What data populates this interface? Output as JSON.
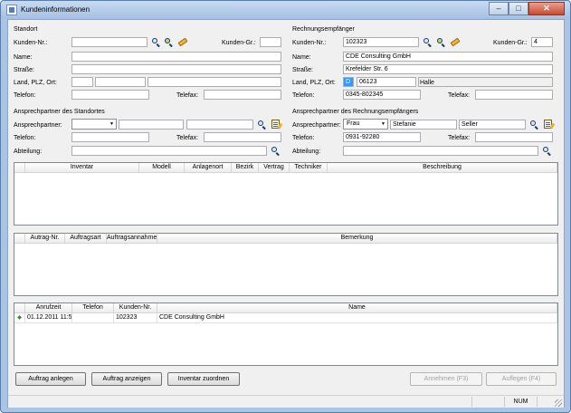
{
  "window": {
    "title": "Kundeninformationen",
    "minimize": "–",
    "maximize": "□",
    "close": "✕"
  },
  "standort": {
    "heading": "Standort",
    "kunden_nr_label": "Kunden-Nr.:",
    "kunden_nr_value": "",
    "kunden_gr_label": "Kunden-Gr.:",
    "kunden_gr_value": "",
    "name_label": "Name:",
    "name_value": "",
    "strasse_label": "Straße:",
    "strasse_value": "",
    "land_label": "Land, PLZ, Ort:",
    "land_value": "",
    "plz_value": "",
    "ort_value": "",
    "telefon_label": "Telefon:",
    "telefon_value": "",
    "telefax_label": "Telefax:",
    "telefax_value": ""
  },
  "rechnung": {
    "heading": "Rechnungsempfänger",
    "kunden_nr_label": "Kunden-Nr.:",
    "kunden_nr_value": "102323",
    "kunden_gr_label": "Kunden-Gr.:",
    "kunden_gr_value": "4",
    "name_label": "Name:",
    "name_value": "CDE Consulting GmbH",
    "strasse_label": "Straße:",
    "strasse_value": "Krefelder Str. 6",
    "land_label": "Land, PLZ, Ort:",
    "land_value": "D",
    "plz_value": "06123",
    "ort_value": "Halle",
    "telefon_label": "Telefon:",
    "telefon_value": "0345-802345",
    "telefax_label": "Telefax:",
    "telefax_value": ""
  },
  "ap_standort": {
    "heading": "Ansprechpartner des Standortes",
    "ansprechpartner_label": "Ansprechpartner:",
    "anrede_value": "",
    "vorname_value": "",
    "nachname_value": "",
    "telefon_label": "Telefon:",
    "telefon_value": "",
    "telefax_label": "Telefax:",
    "telefax_value": "",
    "abteilung_label": "Abteilung:",
    "abteilung_value": ""
  },
  "ap_rechnung": {
    "heading": "Ansprechpartner des Rechnungsempfängers",
    "ansprechpartner_label": "Ansprechpartner:",
    "anrede_value": "Frau",
    "vorname_value": "Stefanie",
    "nachname_value": "Seller",
    "telefon_label": "Telefon:",
    "telefon_value": "0931-92280",
    "telefax_label": "Telefax:",
    "telefax_value": "",
    "abteilung_label": "Abteilung:",
    "abteilung_value": ""
  },
  "inventar_grid": {
    "columns": [
      "",
      "Inventar",
      "Modell",
      "Anlagenort",
      "Bezirk",
      "Vertrag",
      "Techniker",
      "Beschreibung"
    ]
  },
  "auftrag_grid": {
    "columns": [
      "",
      "Autrag-Nr.",
      "Auftragsart",
      "Auftragsannahme",
      "Bemerkung"
    ]
  },
  "anruf_grid": {
    "columns": [
      "",
      "Anrufzeit",
      "Telefon",
      "Kunden-Nr.",
      "Name"
    ],
    "rows": [
      {
        "indicator": "◆",
        "anrufzeit": "01.12.2011 11:5",
        "telefon": "",
        "kunden_nr": "102323",
        "name": "CDE Consulting GmbH"
      }
    ]
  },
  "buttons": {
    "auftrag_anlegen": "Auftrag anlegen",
    "auftrag_anzeigen": "Auftrag anzeigen",
    "inventar_zuordnen": "Inventar zuordnen",
    "annehmen": "Annehmen (F3)",
    "auflegen": "Auflegen (F4)"
  },
  "status": {
    "num": "NUM"
  }
}
